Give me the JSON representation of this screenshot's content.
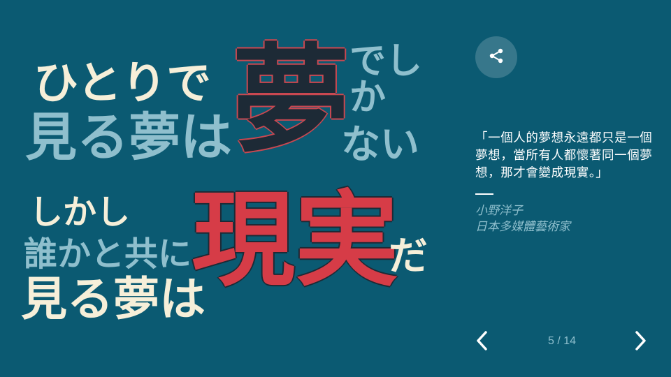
{
  "artwork": {
    "line1": "ひとりで",
    "line2": "見る夢は",
    "line3_big": "夢",
    "line4": "でしか",
    "line5": "ない",
    "line6": "しかし",
    "line7": "誰かと共に",
    "line8": "見る夢は",
    "line9_big": "現実",
    "line10": "だ"
  },
  "quote": {
    "text": "「一個人的夢想永遠都只是一個夢想，當所有人都懷著同一個夢想，那才會變成現實。」",
    "author": "小野洋子",
    "author_title": "日本多媒體藝術家"
  },
  "pagination": {
    "current": "5",
    "separator": "/",
    "total": "14",
    "label": "5 / 14"
  },
  "icons": {
    "share": "share-icon",
    "prev": "chevron-left-icon",
    "next": "chevron-right-icon"
  },
  "colors": {
    "background": "#0b5a72",
    "cream": "#f6efd9",
    "light_blue": "#8fbfcd",
    "red": "#d63c47",
    "dark": "#1d2a36"
  }
}
